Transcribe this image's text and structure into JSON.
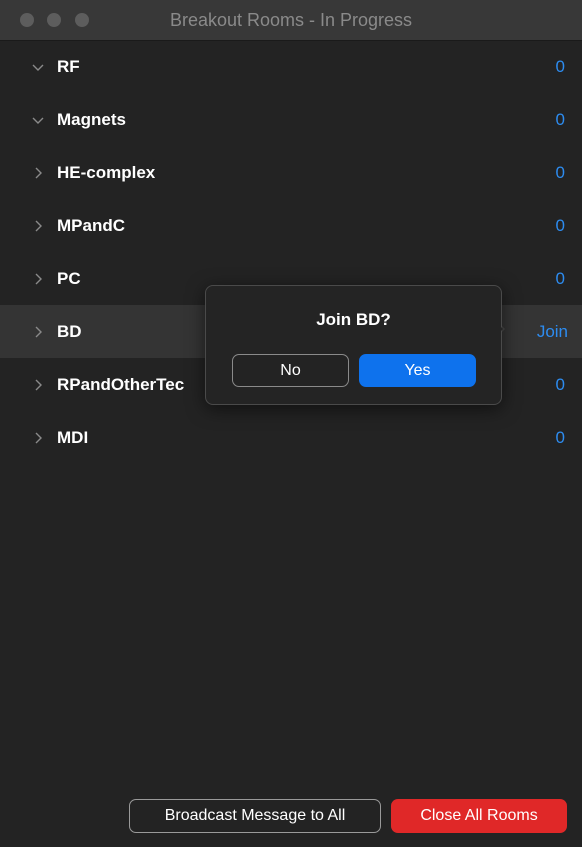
{
  "window": {
    "title": "Breakout Rooms - In Progress"
  },
  "rooms": [
    {
      "name": "RF",
      "count": "0",
      "expanded": true,
      "icon": "chevron-down-icon"
    },
    {
      "name": "Magnets",
      "count": "0",
      "expanded": true,
      "icon": "chevron-down-icon"
    },
    {
      "name": "HE-complex",
      "count": "0",
      "expanded": false,
      "icon": "chevron-right-icon"
    },
    {
      "name": "MPandC",
      "count": "0",
      "expanded": false,
      "icon": "chevron-right-icon"
    },
    {
      "name": "PC",
      "count": "0",
      "expanded": false,
      "icon": "chevron-right-icon"
    },
    {
      "name": "BD",
      "join_label": "Join",
      "expanded": false,
      "icon": "chevron-right-icon"
    },
    {
      "name": "RPandOtherTec",
      "count": "0",
      "expanded": false,
      "icon": "chevron-right-icon"
    },
    {
      "name": "MDI",
      "count": "0",
      "expanded": false,
      "icon": "chevron-right-icon"
    }
  ],
  "popover": {
    "title": "Join BD?",
    "no_label": "No",
    "yes_label": "Yes"
  },
  "footer": {
    "broadcast_label": "Broadcast Message to All",
    "close_all_label": "Close All Rooms"
  },
  "colors": {
    "background": "#232323",
    "accent_blue": "#2d8cf0",
    "primary_button": "#0e72ed",
    "danger_button": "#e02828"
  }
}
